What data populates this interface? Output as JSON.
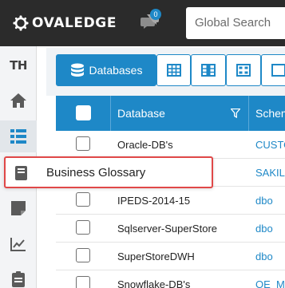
{
  "header": {
    "brand": "OVALEDGE",
    "notification_count": "0",
    "search_placeholder": "Global Search"
  },
  "leftnav": {
    "user_initials": "TH",
    "items": [
      "home",
      "catalog",
      "glossary",
      "notes",
      "analytics",
      "tasks"
    ]
  },
  "tabs": [
    {
      "label": "Databases",
      "active": true
    },
    {
      "label": "",
      "icon": "table-icon"
    },
    {
      "label": "",
      "icon": "columns-icon"
    },
    {
      "label": "",
      "icon": "files-icon"
    },
    {
      "label": "",
      "icon": "reports-icon"
    }
  ],
  "table": {
    "columns": [
      "Database",
      "Schema"
    ],
    "rows": [
      {
        "database": "Oracle-DB's",
        "schema": "CUSTO"
      },
      {
        "database": "",
        "schema": "SAKIL"
      },
      {
        "database": "IPEDS-2014-15",
        "schema": "dbo"
      },
      {
        "database": "Sqlserver-SuperStore",
        "schema": "dbo"
      },
      {
        "database": "SuperStoreDWH",
        "schema": "dbo"
      },
      {
        "database": "Snowflake-DB's",
        "schema": "OE_M"
      }
    ]
  },
  "tooltip": {
    "label": "Business Glossary"
  },
  "colors": {
    "accent": "#1e88c7",
    "topbar": "#2b2b2b",
    "tooltip_border": "#e04848"
  }
}
